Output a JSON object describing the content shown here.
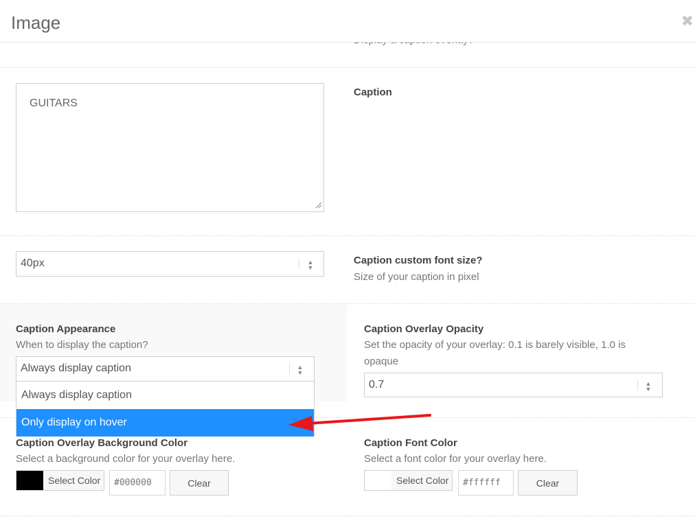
{
  "header": {
    "title": "Image",
    "close_icon": "times-icon"
  },
  "clipped_text": "Display a caption overlay?",
  "caption_field": {
    "value": "GUITARS",
    "label": "Caption"
  },
  "font_size_field": {
    "value": "40px",
    "label": "Caption custom font size?",
    "description": "Size of your caption in pixel"
  },
  "caption_appearance": {
    "label": "Caption Appearance",
    "description": "When to display the caption?",
    "selected": "Always display caption",
    "options": [
      "Always display caption",
      "Only display on hover"
    ],
    "highlighted_index": 1
  },
  "overlay_opacity": {
    "label": "Caption Overlay Opacity",
    "description": "Set the opacity of your overlay: 0.1 is barely visible, 1.0 is opaque",
    "value": "0.7"
  },
  "overlay_bg_color": {
    "label": "Caption Overlay Background Color",
    "description": "Select a background color for your overlay here.",
    "select_label": "Select Color",
    "hex": "#000000",
    "swatch": "#000000",
    "clear_label": "Clear"
  },
  "font_color": {
    "label": "Caption Font Color",
    "description": "Select a font color for your overlay here.",
    "select_label": "Select Color",
    "hex": "#ffffff",
    "swatch": "#ffffff",
    "clear_label": "Clear"
  },
  "colors": {
    "highlight": "#1e90ff",
    "annotation_arrow": "#e8171b"
  }
}
